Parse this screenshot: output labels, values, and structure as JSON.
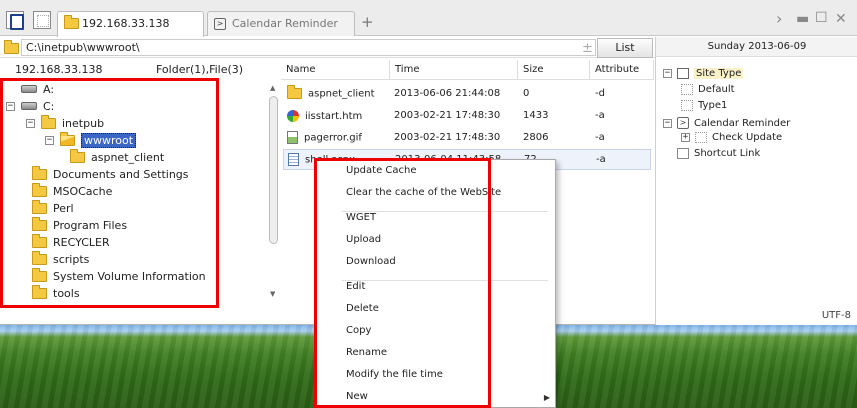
{
  "tabs": [
    {
      "label": "192.168.33.138",
      "active": true
    },
    {
      "label": "Calendar Reminder",
      "active": false
    }
  ],
  "address": {
    "path": "C:\\inetpub\\wwwroot\\",
    "list_label": "List"
  },
  "left": {
    "host": "192.168.33.138",
    "summary": "Folder(1),File(3)",
    "tree": [
      {
        "label": "A:",
        "kind": "drive",
        "level": 0,
        "expander": ""
      },
      {
        "label": "C:",
        "kind": "drive",
        "level": 0,
        "expander": "−"
      },
      {
        "label": "inetpub",
        "kind": "folder",
        "level": 1,
        "expander": "−"
      },
      {
        "label": "wwwroot",
        "kind": "folder-open",
        "level": 2,
        "expander": "−",
        "selected": true
      },
      {
        "label": "aspnet_client",
        "kind": "folder",
        "level": 3,
        "expander": ""
      },
      {
        "label": "Documents and Settings",
        "kind": "folder",
        "level": 1,
        "expander": ""
      },
      {
        "label": "MSOCache",
        "kind": "folder",
        "level": 1,
        "expander": ""
      },
      {
        "label": "Perl",
        "kind": "folder",
        "level": 1,
        "expander": ""
      },
      {
        "label": "Program Files",
        "kind": "folder",
        "level": 1,
        "expander": ""
      },
      {
        "label": "RECYCLER",
        "kind": "folder",
        "level": 1,
        "expander": ""
      },
      {
        "label": "scripts",
        "kind": "folder",
        "level": 1,
        "expander": ""
      },
      {
        "label": "System Volume Information",
        "kind": "folder",
        "level": 1,
        "expander": ""
      },
      {
        "label": "tools",
        "kind": "folder",
        "level": 1,
        "expander": ""
      }
    ]
  },
  "files": {
    "columns": [
      "Name",
      "Time",
      "Size",
      "Attribute"
    ],
    "rows": [
      {
        "name": "aspnet_client",
        "time": "2013-06-06 21:44:08",
        "size": "0",
        "attr": "-d",
        "icon": "folder"
      },
      {
        "name": "iisstart.htm",
        "time": "2003-02-21 17:48:30",
        "size": "1433",
        "attr": "-a",
        "icon": "ie"
      },
      {
        "name": "pagerror.gif",
        "time": "2003-02-21 17:48:30",
        "size": "2806",
        "attr": "-a",
        "icon": "image"
      },
      {
        "name": "shell.aspx",
        "time": "2013-06-04 11:43:58",
        "size": "72",
        "attr": "-a",
        "icon": "doc",
        "selected": true
      }
    ]
  },
  "context_menu": {
    "items": [
      {
        "label": "Update Cache"
      },
      {
        "label": "Clear the cache of the WebSite"
      },
      {
        "sep": true
      },
      {
        "label": "WGET"
      },
      {
        "label": "Upload"
      },
      {
        "label": "Download"
      },
      {
        "sep": true
      },
      {
        "label": "Edit"
      },
      {
        "label": "Delete"
      },
      {
        "label": "Copy"
      },
      {
        "label": "Rename"
      },
      {
        "label": "Modify the file time"
      },
      {
        "label": "New",
        "submenu": true
      }
    ]
  },
  "right_panel": {
    "date": "Sunday 2013-06-09",
    "items": [
      {
        "label": "Site Type",
        "level": 0,
        "expander": "−",
        "selected": true
      },
      {
        "label": "Default",
        "level": 1
      },
      {
        "label": "Type1",
        "level": 1
      },
      {
        "label": "Calendar Reminder",
        "level": 0,
        "expander": "−"
      },
      {
        "label": "Check Update",
        "level": 1,
        "expander": "+"
      },
      {
        "label": "Shortcut Link",
        "level": 0
      }
    ],
    "encoding": "UTF-8"
  },
  "colors": {
    "annotation": "#ee0000",
    "selection": "#3a66c4"
  }
}
